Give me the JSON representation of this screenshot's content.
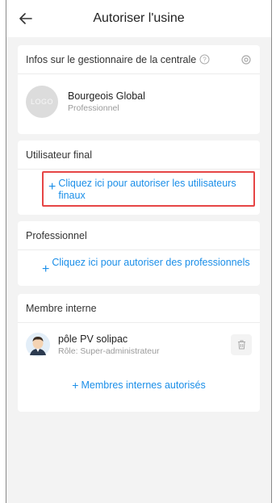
{
  "header": {
    "title": "Autoriser l'usine"
  },
  "plant_manager": {
    "section_title": "Infos sur le gestionnaire de la centrale",
    "logo_text": "LOGO",
    "name": "Bourgeois Global",
    "role": "Professionnel"
  },
  "end_user": {
    "section_title": "Utilisateur final",
    "authorize_link": "Cliquez ici pour autoriser les utilisateurs finaux"
  },
  "professional": {
    "section_title": "Professionnel",
    "authorize_link": "Cliquez ici pour autoriser des professionnels"
  },
  "internal_member": {
    "section_title": "Membre interne",
    "member_name": "pôle PV solipac",
    "member_role": "Rôle: Super-administrateur",
    "add_link": "Membres internes autorisés"
  },
  "colors": {
    "accent": "#1a8ee8",
    "highlight": "#e64545",
    "background": "#f3f3f3"
  },
  "icons": [
    "back-arrow-icon",
    "help-circle-icon",
    "settings-icon",
    "plus-icon",
    "trash-icon",
    "avatar-icon"
  ]
}
